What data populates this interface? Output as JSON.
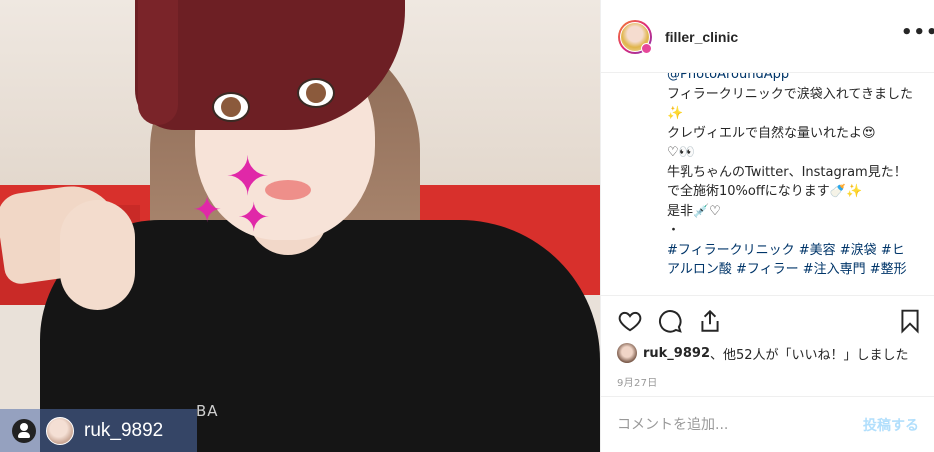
{
  "photo": {
    "shirt_text": "BA",
    "tagged_user": "ruk_9892"
  },
  "post": {
    "username": "filler_clinic",
    "more_label": "•••",
    "caption": {
      "mention": "@PhotoAroundApp",
      "body": "フィラークリニックで涙袋入れてきました✨\nクレヴィエルで自然な量いれたよ😍\n♡👀\n牛乳ちゃんのTwitter、Instagram見た！で全施術10%offになります🍼✨\n是非💉♡\n・",
      "hashtags": "#フィラークリニック #美容 #涙袋 #ヒアルロン酸 #フィラー #注入専門 #整形"
    },
    "likes": {
      "user": "ruk_9892",
      "rest": "、他52人が「いいね！」しました"
    },
    "date": "9月27日",
    "comment_placeholder": "コメントを追加...",
    "post_button": "投稿する"
  },
  "icons": [
    "person-icon",
    "heart-icon",
    "comment-icon",
    "share-icon",
    "bookmark-icon",
    "more-icon"
  ],
  "colors": {
    "link": "#003569",
    "post_disabled": "#b2dffc",
    "border": "#efefef",
    "muted": "#999999"
  }
}
